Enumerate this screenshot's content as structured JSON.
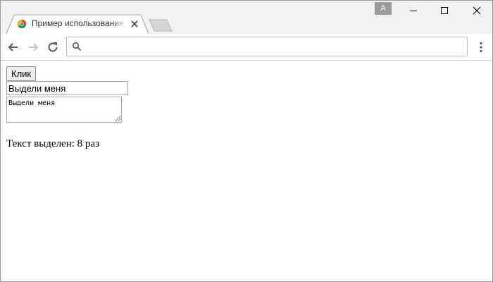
{
  "tab": {
    "title": "Пример использования"
  },
  "profile": {
    "initial": "A"
  },
  "omnibox": {
    "value": "",
    "placeholder": ""
  },
  "page": {
    "button_label": "Клик",
    "input_value": "Выдели меня",
    "textarea_value": "Выдели меня",
    "status_text": "Текст выделен: 8 раз"
  },
  "colors": {
    "tabstrip": "#f2f2f2",
    "page": "#ffffff",
    "profile_badge": "#9b9b9b"
  },
  "icons": [
    "chrome-favicon-icon",
    "close-icon",
    "new-tab-icon",
    "minimize-icon",
    "maximize-icon",
    "window-close-icon",
    "back-arrow-icon",
    "forward-arrow-icon",
    "reload-icon",
    "search-icon",
    "menu-dots-icon"
  ]
}
